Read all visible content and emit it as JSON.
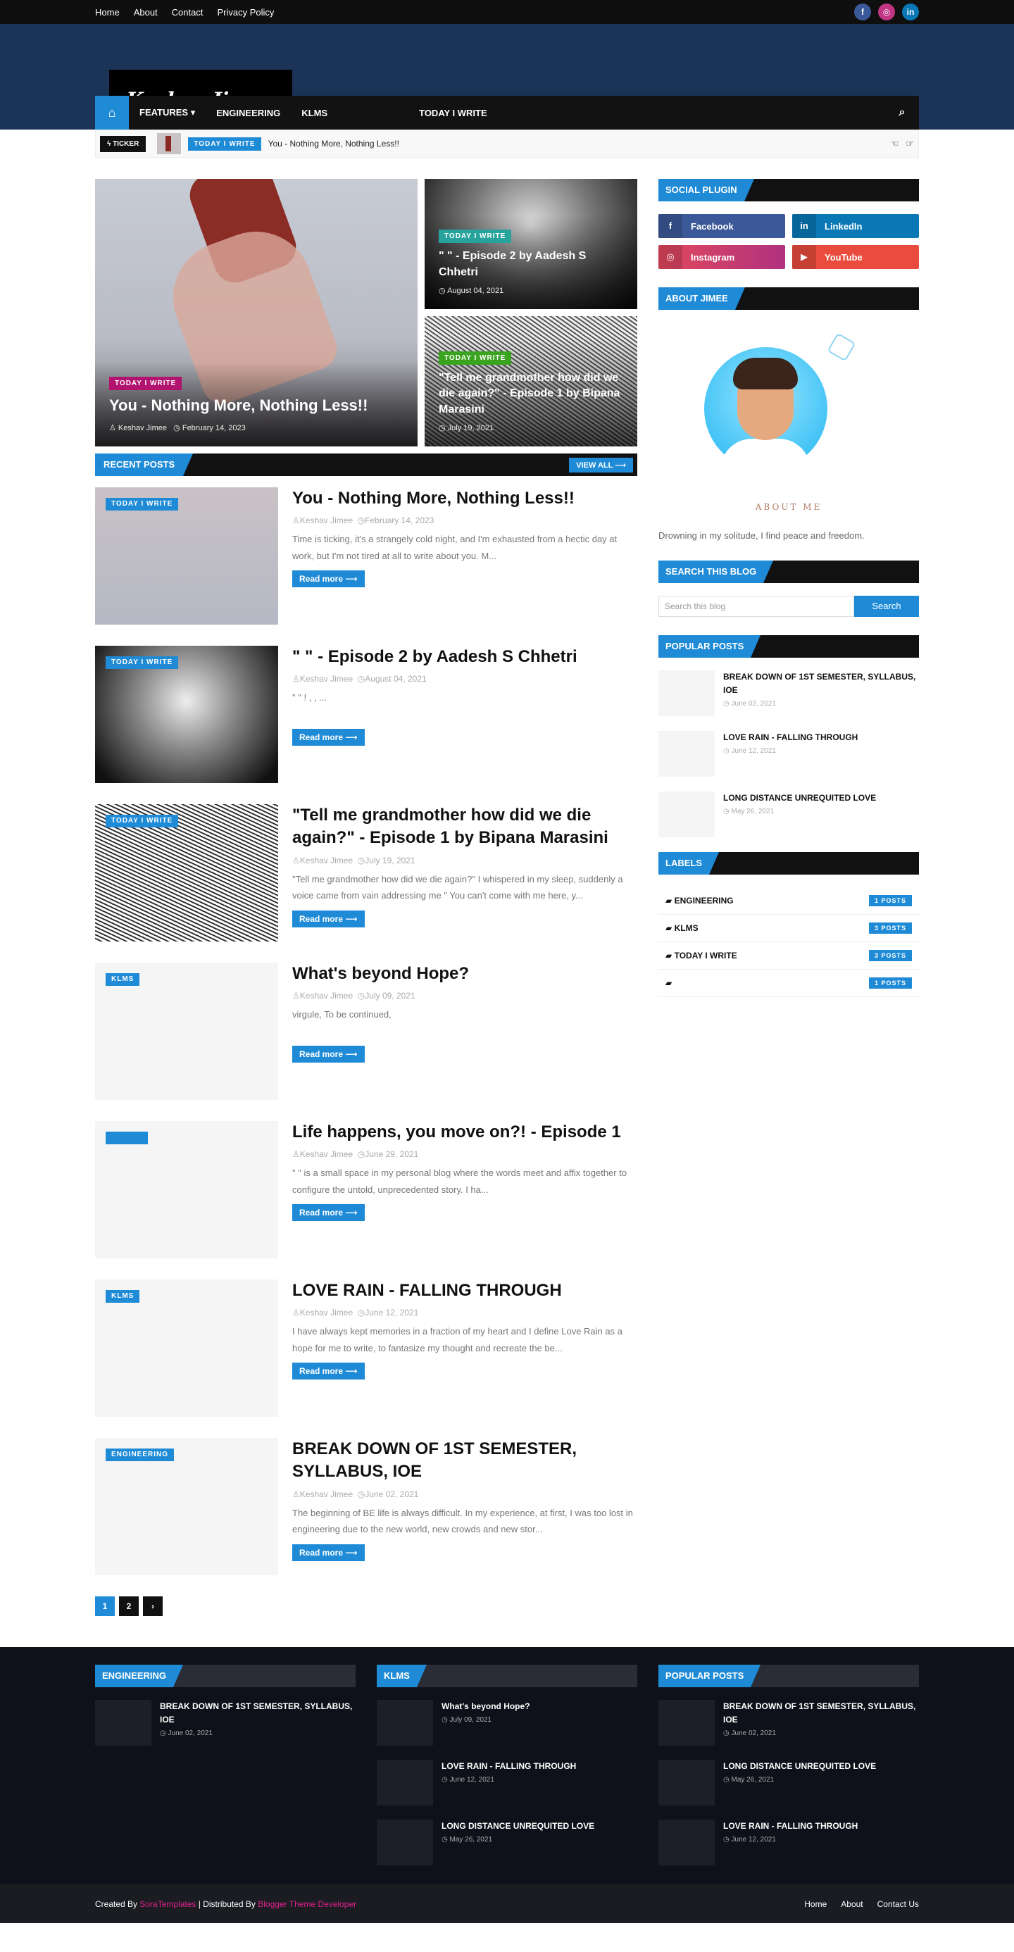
{
  "topbar": {
    "menu": [
      "Home",
      "About",
      "Contact",
      "Privacy Policy"
    ],
    "social": [
      "f",
      "ig",
      "in"
    ]
  },
  "header": {
    "logo_text": "Keshav Jimee"
  },
  "nav": {
    "items": [
      "FEATURES",
      "ENGINEERING",
      "KLMS",
      "TODAY I WRITE"
    ]
  },
  "ticker": {
    "label": "TICKER",
    "badge": "TODAY I WRITE",
    "title": "You - Nothing More, Nothing Less!!"
  },
  "featured": {
    "big": {
      "badge": "TODAY I WRITE",
      "title": "You - Nothing More, Nothing Less!!",
      "author": "Keshav Jimee",
      "date": "February 14, 2023"
    },
    "small1": {
      "badge": "TODAY I WRITE",
      "title": "\"        \" - Episode 2 by Aadesh S Chhetri",
      "date": "August 04, 2021"
    },
    "small2": {
      "badge": "TODAY I WRITE",
      "title": "\"Tell me grandmother how did we die again?\" - Episode 1 by Bipana Marasini",
      "date": "July 19, 2021"
    }
  },
  "recent": {
    "heading": "RECENT POSTS",
    "view_all": "VIEW ALL",
    "read_more": "Read more",
    "posts": [
      {
        "badge": "TODAY I WRITE",
        "title": "You - Nothing More, Nothing Less!!",
        "author": "Keshav Jimee",
        "date": "February 14, 2023",
        "snippet": "Time is ticking, it's a strangely cold night, and I'm exhausted from a hectic day at work, but I'm not tired at all to write about you. M..."
      },
      {
        "badge": "TODAY I WRITE",
        "title": "\"        \" - Episode 2 by Aadesh S Chhetri",
        "author": "Keshav Jimee",
        "date": "August 04, 2021",
        "snippet": "\"      \"                    !                                                   ,                                   ,                          ..."
      },
      {
        "badge": "TODAY I WRITE",
        "title": "\"Tell me grandmother how did we die again?\" - Episode 1 by Bipana Marasini",
        "author": "Keshav Jimee",
        "date": "July 19, 2021",
        "snippet": "\"Tell me grandmother how did we die again?\" I whispered in my sleep, suddenly a voice came from vain addressing me \" You can't come with me here, y..."
      },
      {
        "badge": "KLMS",
        "title": "What's beyond Hope?",
        "author": "Keshav Jimee",
        "date": "July 09, 2021",
        "snippet": "virgule, To be continued,"
      },
      {
        "badge": "",
        "title": "Life happens, you move on?! - Episode 1",
        "author": "Keshav Jimee",
        "date": "June 29, 2021",
        "snippet": "\"                 \" is a small space in my personal blog where the words meet and affix together to configure the untold, unprecedented story. I ha..."
      },
      {
        "badge": "KLMS",
        "title": "LOVE RAIN - FALLING THROUGH",
        "author": "Keshav Jimee",
        "date": "June 12, 2021",
        "snippet": "I have always kept memories in a fraction of my heart and I define Love Rain as a hope for me to write, to fantasize my thought and recreate the be..."
      },
      {
        "badge": "ENGINEERING",
        "title": "BREAK DOWN OF 1ST SEMESTER, SYLLABUS, IOE",
        "author": "Keshav Jimee",
        "date": "June 02, 2021",
        "snippet": "The beginning of BE life is always difficult. In my experience, at first, I was too lost in engineering due to the new world, new crowds and new stor..."
      }
    ]
  },
  "pager": [
    "1",
    "2",
    "›"
  ],
  "sidebar": {
    "social_heading": "SOCIAL PLUGIN",
    "social": [
      {
        "name": "Facebook",
        "icon": "f"
      },
      {
        "name": "LinkedIn",
        "icon": "in"
      },
      {
        "name": "Instagram",
        "icon": "◎"
      },
      {
        "name": "YouTube",
        "icon": "▶"
      }
    ],
    "about_heading": "ABOUT JIMEE",
    "about_name": "ABOUT ME",
    "about_text": "Drowning in my solitude, I find peace and freedom.",
    "search_heading": "SEARCH THIS BLOG",
    "search_placeholder": "Search this blog",
    "search_button": "Search",
    "popular_heading": "POPULAR POSTS",
    "popular": [
      {
        "title": "BREAK DOWN OF 1ST SEMESTER, SYLLABUS, IOE",
        "date": "June 02, 2021"
      },
      {
        "title": "LOVE RAIN - FALLING THROUGH",
        "date": "June 12, 2021"
      },
      {
        "title": "LONG DISTANCE UNREQUITED LOVE",
        "date": "May 26, 2021"
      }
    ],
    "labels_heading": "LABELS",
    "labels": [
      {
        "name": "ENGINEERING",
        "count": "1 POSTS"
      },
      {
        "name": "KLMS",
        "count": "3 POSTS"
      },
      {
        "name": "TODAY I WRITE",
        "count": "3 POSTS"
      },
      {
        "name": "",
        "count": "1 POSTS"
      }
    ]
  },
  "footer": {
    "cols": [
      {
        "heading": "ENGINEERING",
        "items": [
          {
            "title": "BREAK DOWN OF 1ST SEMESTER, SYLLABUS, IOE",
            "date": "June 02, 2021"
          }
        ]
      },
      {
        "heading": "KLMS",
        "items": [
          {
            "title": "What's beyond Hope?",
            "date": "July 09, 2021"
          },
          {
            "title": "LOVE RAIN - FALLING THROUGH",
            "date": "June 12, 2021"
          },
          {
            "title": "LONG DISTANCE UNREQUITED LOVE",
            "date": "May 26, 2021"
          }
        ]
      },
      {
        "heading": "POPULAR POSTS",
        "items": [
          {
            "title": "BREAK DOWN OF 1ST SEMESTER, SYLLABUS, IOE",
            "date": "June 02, 2021"
          },
          {
            "title": "LONG DISTANCE UNREQUITED LOVE",
            "date": "May 26, 2021"
          },
          {
            "title": "LOVE RAIN - FALLING THROUGH",
            "date": "June 12, 2021"
          }
        ]
      }
    ],
    "credit_created": "Created By",
    "credit_sora": "SoraTemplates",
    "credit_dist": "| Distributed By",
    "credit_blogger": "Blogger Theme Developer",
    "menu": [
      "Home",
      "About",
      "Contact Us"
    ]
  },
  "colors": {
    "accent": "#1f8bd7",
    "header_bg": "#1a3356",
    "footer_bg": "#0e1119"
  }
}
